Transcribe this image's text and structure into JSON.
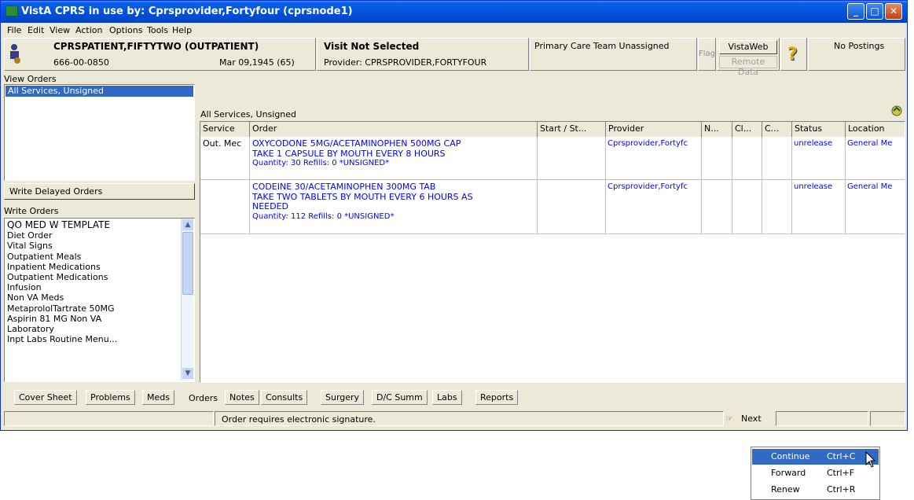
{
  "window": {
    "title": "VistA CPRS in use by: Cprsprovider,Fortyfour  (cprsnode1)"
  },
  "menubar": [
    "File",
    "Edit",
    "View",
    "Action",
    "Options",
    "Tools",
    "Help"
  ],
  "patient": {
    "name": "CPRSPATIENT,FIFTYTWO (OUTPATIENT)",
    "ssn": "666-00-0850",
    "dob": "Mar 09,1945 (65)"
  },
  "visit": {
    "title": "Visit Not Selected",
    "provider": "Provider:  CPRSPROVIDER,FORTYFOUR"
  },
  "care_team": "Primary Care Team Unassigned",
  "flag": "Flag",
  "vistaweb": {
    "label": "VistaWeb",
    "remote": "Remote Data"
  },
  "postings": "No Postings",
  "view_orders": {
    "label": "View Orders",
    "items": [
      "All Services, Unsigned"
    ]
  },
  "write_delayed": "Write Delayed Orders",
  "write_orders": {
    "label": "Write Orders",
    "items": [
      "QO MED W TEMPLATE",
      "Diet Order",
      "Vital Signs",
      "Outpatient Meals",
      "Inpatient Medications",
      "Outpatient Medications",
      "Infusion",
      "Non VA Meds",
      "MetaprololTartrate 50MG",
      "Aspirin 81 MG Non VA",
      "Laboratory",
      "Inpt Labs Routine Menu..."
    ]
  },
  "orders": {
    "caption": "All Services, Unsigned",
    "columns": [
      "Service",
      "Order",
      "Start / St...",
      "Provider",
      "N...",
      "Cl...",
      "C...",
      "Status",
      "Location"
    ],
    "rows": [
      {
        "service": "Out. Mec",
        "order": [
          "OXYCODONE 5MG/ACETAMINOPHEN 500MG CAP",
          "TAKE 1 CAPSULE BY MOUTH EVERY 8 HOURS"
        ],
        "qty": "Quantity: 30 Refills: 0 *UNSIGNED*",
        "provider": "Cprsprovider,Fortyfc",
        "status": "unrelease",
        "location": "General Me"
      },
      {
        "service": "",
        "order": [
          "CODEINE 30/ACETAMINOPHEN 300MG TAB",
          "TAKE TWO TABLETS BY MOUTH EVERY 6 HOURS AS",
          "NEEDED"
        ],
        "qty": "Quantity: 112 Refills: 0 *UNSIGNED*",
        "provider": "Cprsprovider,Fortyfc",
        "status": "unrelease",
        "location": "General Me"
      }
    ]
  },
  "tabs": [
    "Cover Sheet",
    "Problems",
    "Meds",
    "Orders",
    "Notes",
    "Consults",
    "Surgery",
    "D/C Summ",
    "Labs",
    "Reports"
  ],
  "active_tab": "Orders",
  "status": {
    "message": "Order requires electronic signature.",
    "next": "Next"
  },
  "context_menu": [
    {
      "label": "Continue",
      "shortcut": "Ctrl+C"
    },
    {
      "label": "Forward",
      "shortcut": "Ctrl+F"
    },
    {
      "label": "Renew",
      "shortcut": "Ctrl+R"
    }
  ],
  "colors": {
    "selection": "#316ac5",
    "order_text": "#0000ff",
    "title_bar": "#0053e1"
  }
}
